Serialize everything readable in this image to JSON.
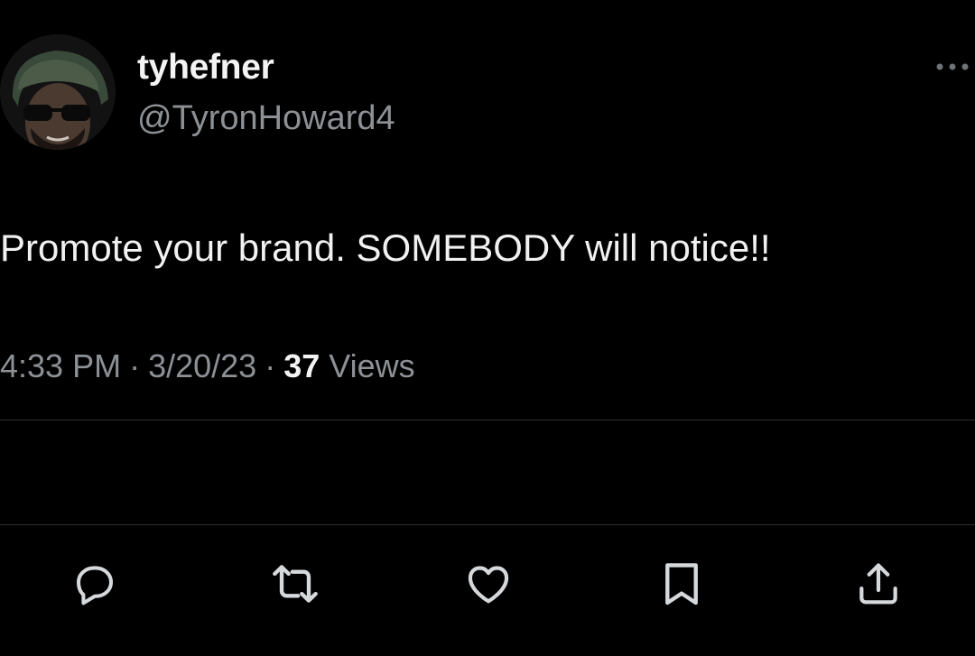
{
  "author": {
    "display_name": "tyhefner",
    "handle": "@TyronHoward4",
    "avatar_icon": "user-avatar"
  },
  "tweet": {
    "text": "Promote your brand. SOMEBODY will notice!!",
    "time": "4:33 PM",
    "separator": "·",
    "date": "3/20/23",
    "views_count": "37",
    "views_label": "Views"
  },
  "actions": [
    {
      "name": "reply",
      "icon": "reply-icon"
    },
    {
      "name": "retweet",
      "icon": "retweet-icon"
    },
    {
      "name": "like",
      "icon": "heart-icon"
    },
    {
      "name": "bookmark",
      "icon": "bookmark-icon"
    },
    {
      "name": "share",
      "icon": "share-icon"
    }
  ],
  "colors": {
    "background": "#000000",
    "primary_text": "#e7e9ea",
    "secondary_text": "#8d9195",
    "divider": "#2b2e31",
    "icon": "#d6d9db"
  }
}
